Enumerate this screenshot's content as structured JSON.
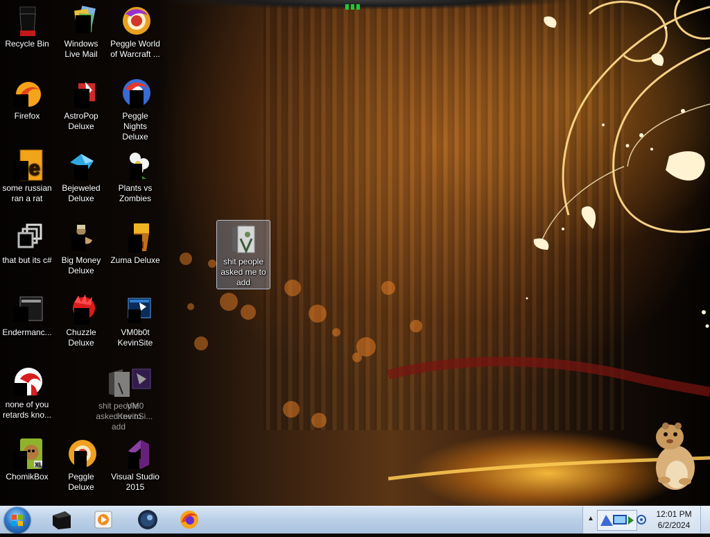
{
  "desktop": {
    "icons": [
      {
        "label": "Recycle Bin",
        "icon": "recycle-bin-icon"
      },
      {
        "label": "Windows Live Mail",
        "icon": "windows-live-mail-icon"
      },
      {
        "label": "Peggle World of Warcraft ...",
        "icon": "peggle-wow-icon"
      },
      {
        "label": "Firefox",
        "icon": "firefox-icon"
      },
      {
        "label": "AstroPop Deluxe",
        "icon": "astropop-icon"
      },
      {
        "label": "Peggle Nights Deluxe",
        "icon": "peggle-nights-icon"
      },
      {
        "label": "some russian ran a rat",
        "icon": "shortcut-e-icon"
      },
      {
        "label": "Bejeweled Deluxe",
        "icon": "bejeweled-icon"
      },
      {
        "label": "Plants vs Zombies",
        "icon": "plants-vs-zombies-icon"
      },
      {
        "label": "that but its c#",
        "icon": "stacked-windows-icon"
      },
      {
        "label": "Big Money Deluxe",
        "icon": "big-money-icon"
      },
      {
        "label": "Zuma Deluxe",
        "icon": "zuma-icon"
      },
      {
        "label": "Endermanc...",
        "icon": "terminal-icon"
      },
      {
        "label": "Chuzzle Deluxe",
        "icon": "chuzzle-icon"
      },
      {
        "label": "VM0b0t KevinSite",
        "icon": "vm-icon"
      },
      {
        "label": "none of you retards kno...",
        "icon": "red-app-icon"
      },
      {
        "label": "ChomikBox",
        "icon": "chomikbox-icon"
      },
      {
        "label": "Peggle Deluxe",
        "icon": "peggle-deluxe-icon"
      },
      {
        "label": "Visual Studio 2015",
        "icon": "visual-studio-icon"
      }
    ],
    "selected_folder": {
      "label": "shit people asked me to add",
      "icon": "folder-icon"
    },
    "drag_ghost_folder": {
      "label": "shit people asked me to add"
    },
    "drag_ghost_vm": {
      "label": "VM0 KevinSi..."
    }
  },
  "taskbar": {
    "pinned": [
      {
        "name": "start-button"
      },
      {
        "name": "taskbar-terminal-button",
        "icon": "terminal-icon"
      },
      {
        "name": "taskbar-media-player-button",
        "icon": "media-player-icon"
      },
      {
        "name": "taskbar-steam-button",
        "icon": "steam-icon"
      },
      {
        "name": "taskbar-firefox-button",
        "icon": "firefox-icon"
      }
    ],
    "tray": {
      "overflow_glyph": "▲",
      "time": "12:01 PM",
      "date": "6/2/2024"
    }
  }
}
